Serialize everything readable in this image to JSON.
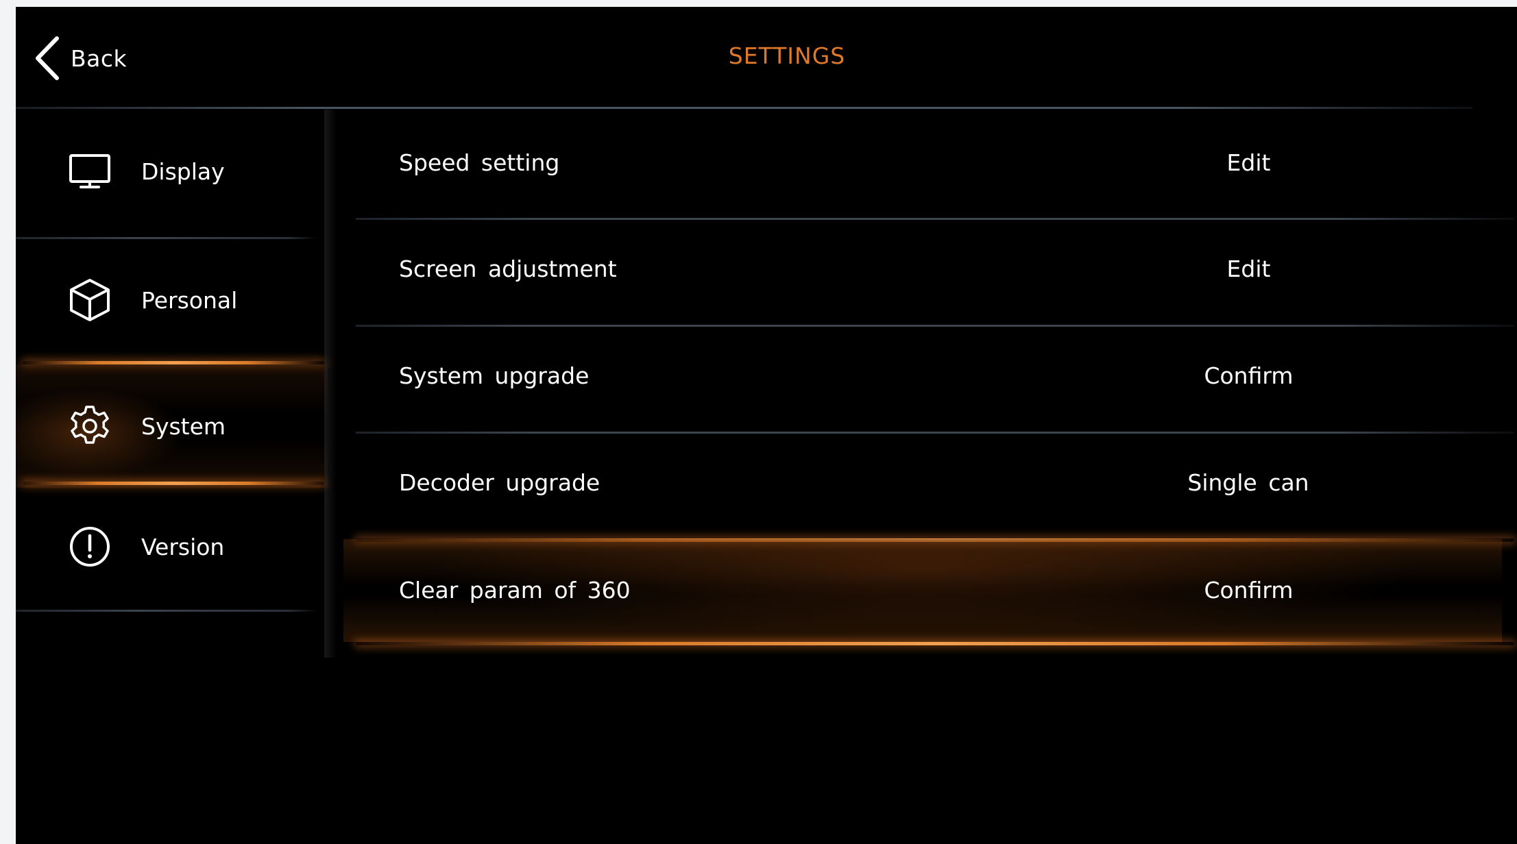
{
  "header": {
    "back_label": "Back",
    "title": "SETTINGS",
    "title_color": "#e0792a"
  },
  "sidebar": {
    "items": [
      {
        "label": "Display",
        "icon": "monitor-icon",
        "active": false
      },
      {
        "label": "Personal",
        "icon": "cube-icon",
        "active": false
      },
      {
        "label": "System",
        "icon": "gear-icon",
        "active": true
      },
      {
        "label": "Version",
        "icon": "info-circle-icon",
        "active": false
      }
    ]
  },
  "settings_list": {
    "rows": [
      {
        "label": "Speed setting",
        "action": "Edit",
        "active": false
      },
      {
        "label": "Screen adjustment",
        "action": "Edit",
        "active": false
      },
      {
        "label": "System upgrade",
        "action": "Confirm",
        "active": false
      },
      {
        "label": "Decoder upgrade",
        "action": "Single can",
        "active": false
      },
      {
        "label": "Clear param of 360",
        "action": "Confirm",
        "active": true
      }
    ]
  },
  "accent_color": "#e8893a"
}
